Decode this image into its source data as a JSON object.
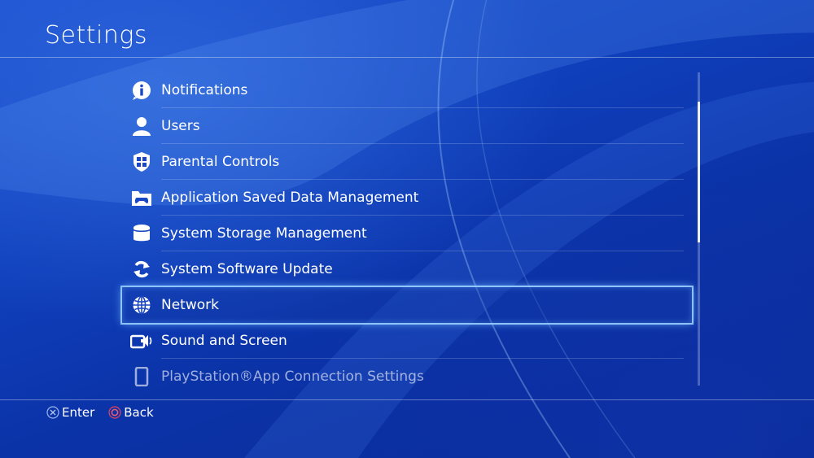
{
  "header": {
    "title": "Settings"
  },
  "menu": {
    "items": [
      {
        "label": "Notifications",
        "icon": "info-icon"
      },
      {
        "label": "Users",
        "icon": "user-icon"
      },
      {
        "label": "Parental Controls",
        "icon": "parental-shield-icon"
      },
      {
        "label": "Application Saved Data Management",
        "icon": "controller-folder-icon"
      },
      {
        "label": "System Storage Management",
        "icon": "storage-cylinder-icon"
      },
      {
        "label": "System Software Update",
        "icon": "refresh-icon"
      },
      {
        "label": "Network",
        "icon": "globe-icon",
        "selected": true
      },
      {
        "label": "Sound and Screen",
        "icon": "screen-sound-icon"
      },
      {
        "label": "PlayStation®App Connection Settings",
        "icon": "phone-icon"
      }
    ]
  },
  "scroll": {
    "position": 0.17,
    "visible_fraction": 0.45
  },
  "footer": {
    "enter_label": "Enter",
    "back_label": "Back"
  },
  "colors": {
    "background": "#0a2fa6",
    "selection_glow": "#96cdff",
    "back_button_ring": "#e8405a",
    "enter_button_ring": "#9ab4e8"
  }
}
